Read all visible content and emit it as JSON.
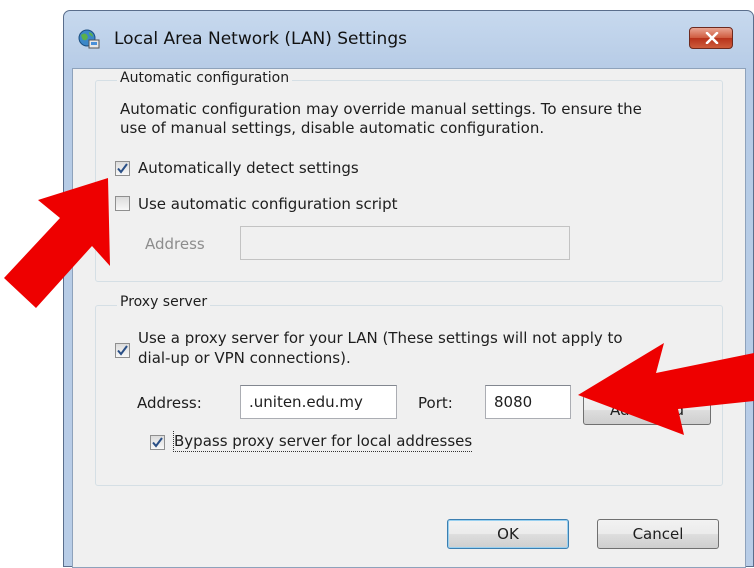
{
  "dialog": {
    "title": "Local Area Network (LAN) Settings"
  },
  "auto_config": {
    "group_label": "Automatic configuration",
    "description_line1": "Automatic configuration may override manual settings.  To ensure the",
    "description_line2": "use of manual settings, disable automatic configuration.",
    "auto_detect_label": "Automatically detect settings",
    "auto_detect_checked": true,
    "use_script_label": "Use automatic configuration script",
    "use_script_checked": false,
    "address_label": "Address",
    "address_value": ""
  },
  "proxy": {
    "group_label": "Proxy server",
    "use_proxy_line1": "Use a proxy server for your LAN (These settings will not apply to",
    "use_proxy_line2": "dial-up or VPN connections).",
    "use_proxy_checked": true,
    "address_label": "Address:",
    "address_value": ".uniten.edu.my",
    "port_label": "Port:",
    "port_value": "8080",
    "advanced_label": "Advanced",
    "bypass_label": "Bypass proxy server for local addresses",
    "bypass_checked": true
  },
  "buttons": {
    "ok": "OK",
    "cancel": "Cancel"
  },
  "colors": {
    "annotation_arrow": "#ee0000",
    "close_button": "#c7452a",
    "checkmark": "#2a4f86"
  },
  "icons": {
    "title": "network-globe-icon",
    "close": "close-x-icon",
    "checkmark": "checkmark-icon"
  }
}
